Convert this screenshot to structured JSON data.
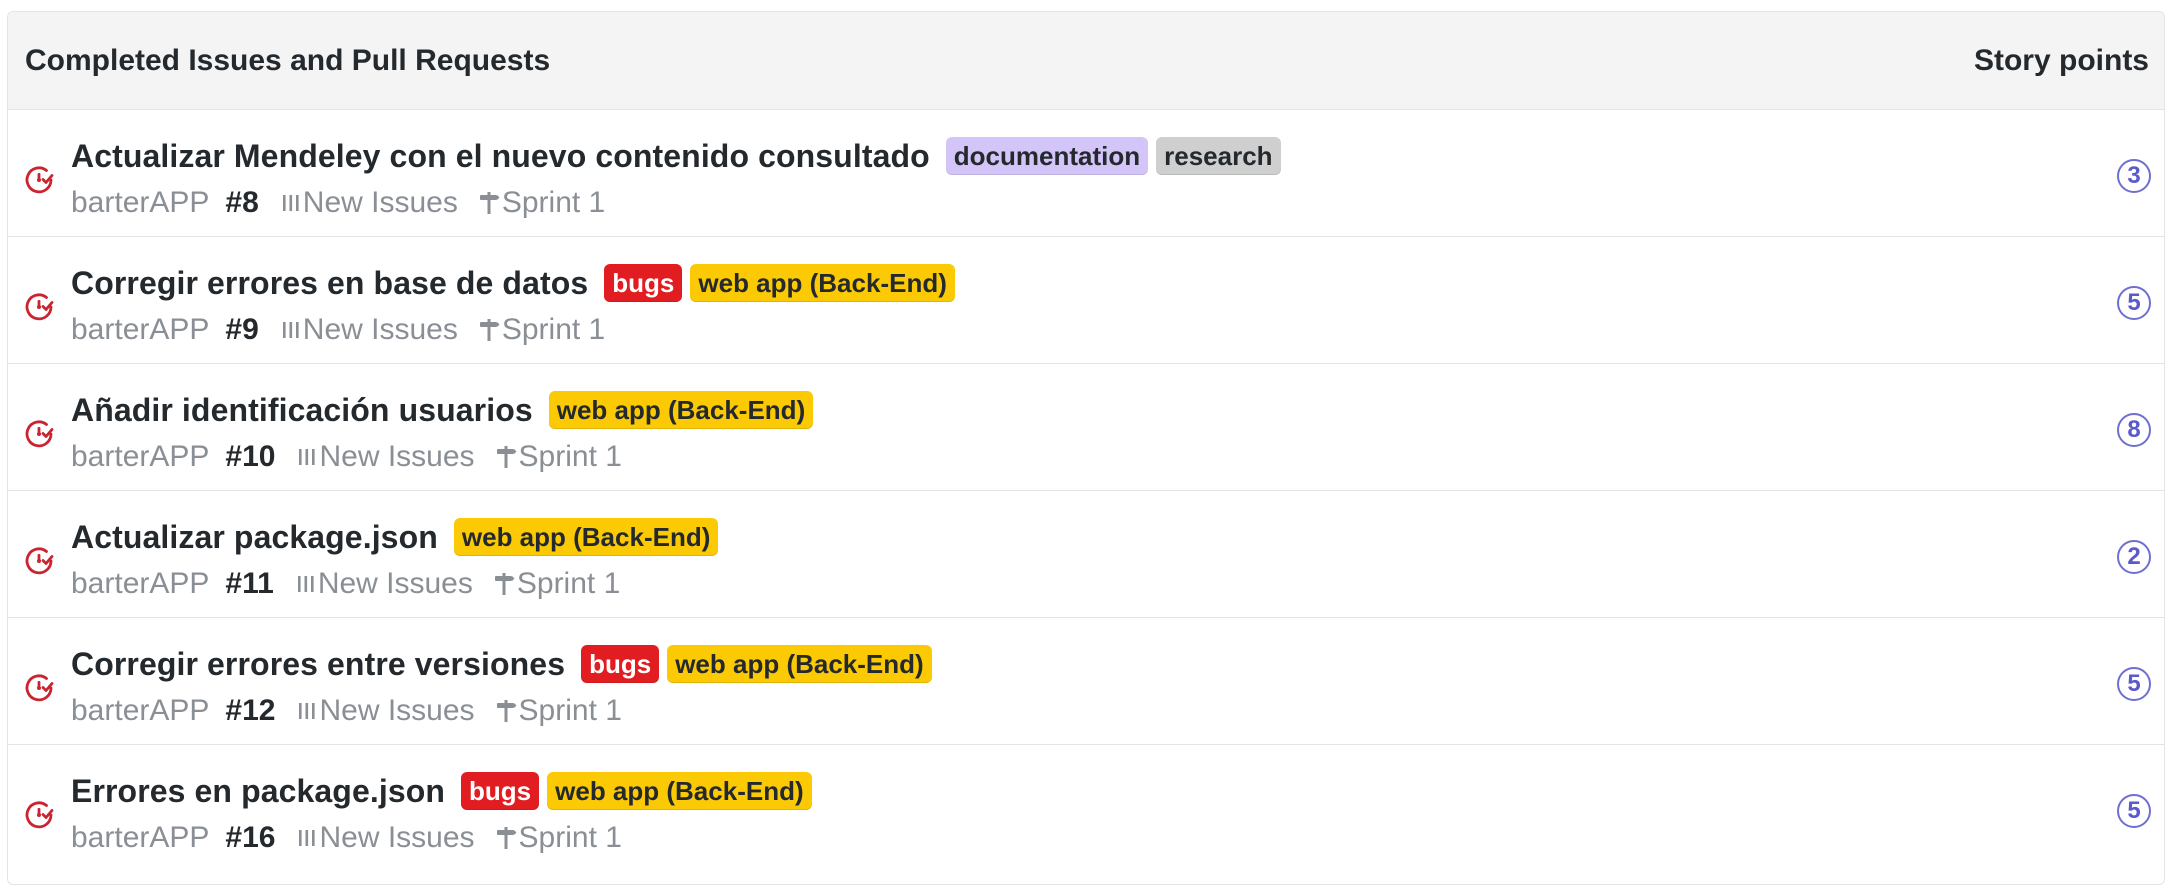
{
  "header": {
    "title": "Completed Issues and Pull Requests",
    "points_column": "Story points"
  },
  "colors": {
    "closed_icon": "#cb2431",
    "points_badge": "#5a5acb",
    "label_documentation": "#d4c5f9",
    "label_research": "#cfcfcf",
    "label_bugs": "#e11d21",
    "label_webapp": "#fbca04"
  },
  "icons": {
    "state": "closed-issue-icon",
    "project": "project-icon",
    "milestone": "milestone-icon"
  },
  "issues": [
    {
      "title": "Actualizar Mendeley con el nuevo contenido consultado",
      "labels": [
        {
          "name": "documentation",
          "kind": "documentation"
        },
        {
          "name": "research",
          "kind": "research"
        }
      ],
      "repo": "barterAPP",
      "number": "#8",
      "project": "New Issues",
      "milestone": "Sprint 1",
      "points": "3"
    },
    {
      "title": "Corregir errores en base de datos",
      "labels": [
        {
          "name": "bugs",
          "kind": "bugs"
        },
        {
          "name": "web app (Back-End)",
          "kind": "webapp"
        }
      ],
      "repo": "barterAPP",
      "number": "#9",
      "project": "New Issues",
      "milestone": "Sprint 1",
      "points": "5"
    },
    {
      "title": "Añadir identificación usuarios",
      "labels": [
        {
          "name": "web app (Back-End)",
          "kind": "webapp"
        }
      ],
      "repo": "barterAPP",
      "number": "#10",
      "project": "New Issues",
      "milestone": "Sprint 1",
      "points": "8"
    },
    {
      "title": "Actualizar package.json",
      "labels": [
        {
          "name": "web app (Back-End)",
          "kind": "webapp"
        }
      ],
      "repo": "barterAPP",
      "number": "#11",
      "project": "New Issues",
      "milestone": "Sprint 1",
      "points": "2"
    },
    {
      "title": "Corregir errores entre versiones",
      "labels": [
        {
          "name": "bugs",
          "kind": "bugs"
        },
        {
          "name": "web app (Back-End)",
          "kind": "webapp"
        }
      ],
      "repo": "barterAPP",
      "number": "#12",
      "project": "New Issues",
      "milestone": "Sprint 1",
      "points": "5"
    },
    {
      "title": "Errores en package.json",
      "labels": [
        {
          "name": "bugs",
          "kind": "bugs"
        },
        {
          "name": "web app (Back-End)",
          "kind": "webapp"
        }
      ],
      "repo": "barterAPP",
      "number": "#16",
      "project": "New Issues",
      "milestone": "Sprint 1",
      "points": "5"
    }
  ]
}
